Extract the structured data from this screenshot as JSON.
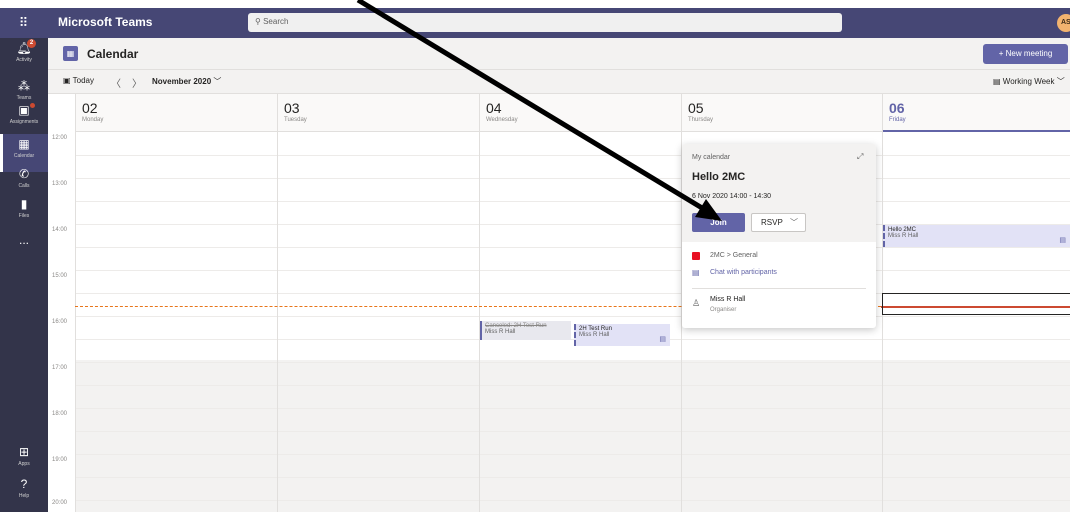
{
  "app": {
    "title": "Microsoft Teams",
    "user_initials": "AS"
  },
  "search": {
    "placeholder": "Search"
  },
  "rail": {
    "items": [
      {
        "label": "Activity",
        "icon": "bell-icon",
        "badge": "2"
      },
      {
        "label": "Teams",
        "icon": "teams-icon"
      },
      {
        "label": "Assignments",
        "icon": "assignments-icon"
      },
      {
        "label": "Calendar",
        "icon": "calendar-icon"
      },
      {
        "label": "Calls",
        "icon": "phone-icon"
      },
      {
        "label": "Files",
        "icon": "file-icon"
      },
      {
        "label": "...",
        "icon": "more-icon"
      },
      {
        "label": "Apps",
        "icon": "apps-icon"
      },
      {
        "label": "Help",
        "icon": "help-icon"
      }
    ]
  },
  "header": {
    "title": "Calendar",
    "new_meeting": "+ New meeting"
  },
  "nav": {
    "today": "Today",
    "month": "November 2020",
    "view": "Working Week"
  },
  "days": [
    {
      "num": "02",
      "name": "Monday"
    },
    {
      "num": "03",
      "name": "Tuesday"
    },
    {
      "num": "04",
      "name": "Wednesday"
    },
    {
      "num": "05",
      "name": "Thursday"
    },
    {
      "num": "06",
      "name": "Friday"
    }
  ],
  "hours": [
    "12:00",
    "13:00",
    "14:00",
    "15:00",
    "16:00",
    "17:00",
    "18:00",
    "19:00",
    "20:00"
  ],
  "events": [
    {
      "title": "Canceled: 2H Test Run",
      "organizer": "Miss R Hall"
    },
    {
      "title": "2H Test Run",
      "organizer": "Miss R Hall"
    },
    {
      "title": "Hello 2MC",
      "organizer": "Miss R Hall"
    }
  ],
  "popup": {
    "calendar": "My calendar",
    "title": "Hello 2MC",
    "when": "6 Nov 2020 14:00 - 14:30",
    "join": "Join",
    "rsvp": "RSVP",
    "channel": "2MC > General",
    "chat": "Chat with participants",
    "organizer_name": "Miss R Hall",
    "organizer_role": "Organiser"
  },
  "colors": {
    "brand": "#464775",
    "accent": "#6264a7",
    "rail": "#33344a",
    "now_line": "#cc4a31",
    "channel": "#e81123"
  }
}
